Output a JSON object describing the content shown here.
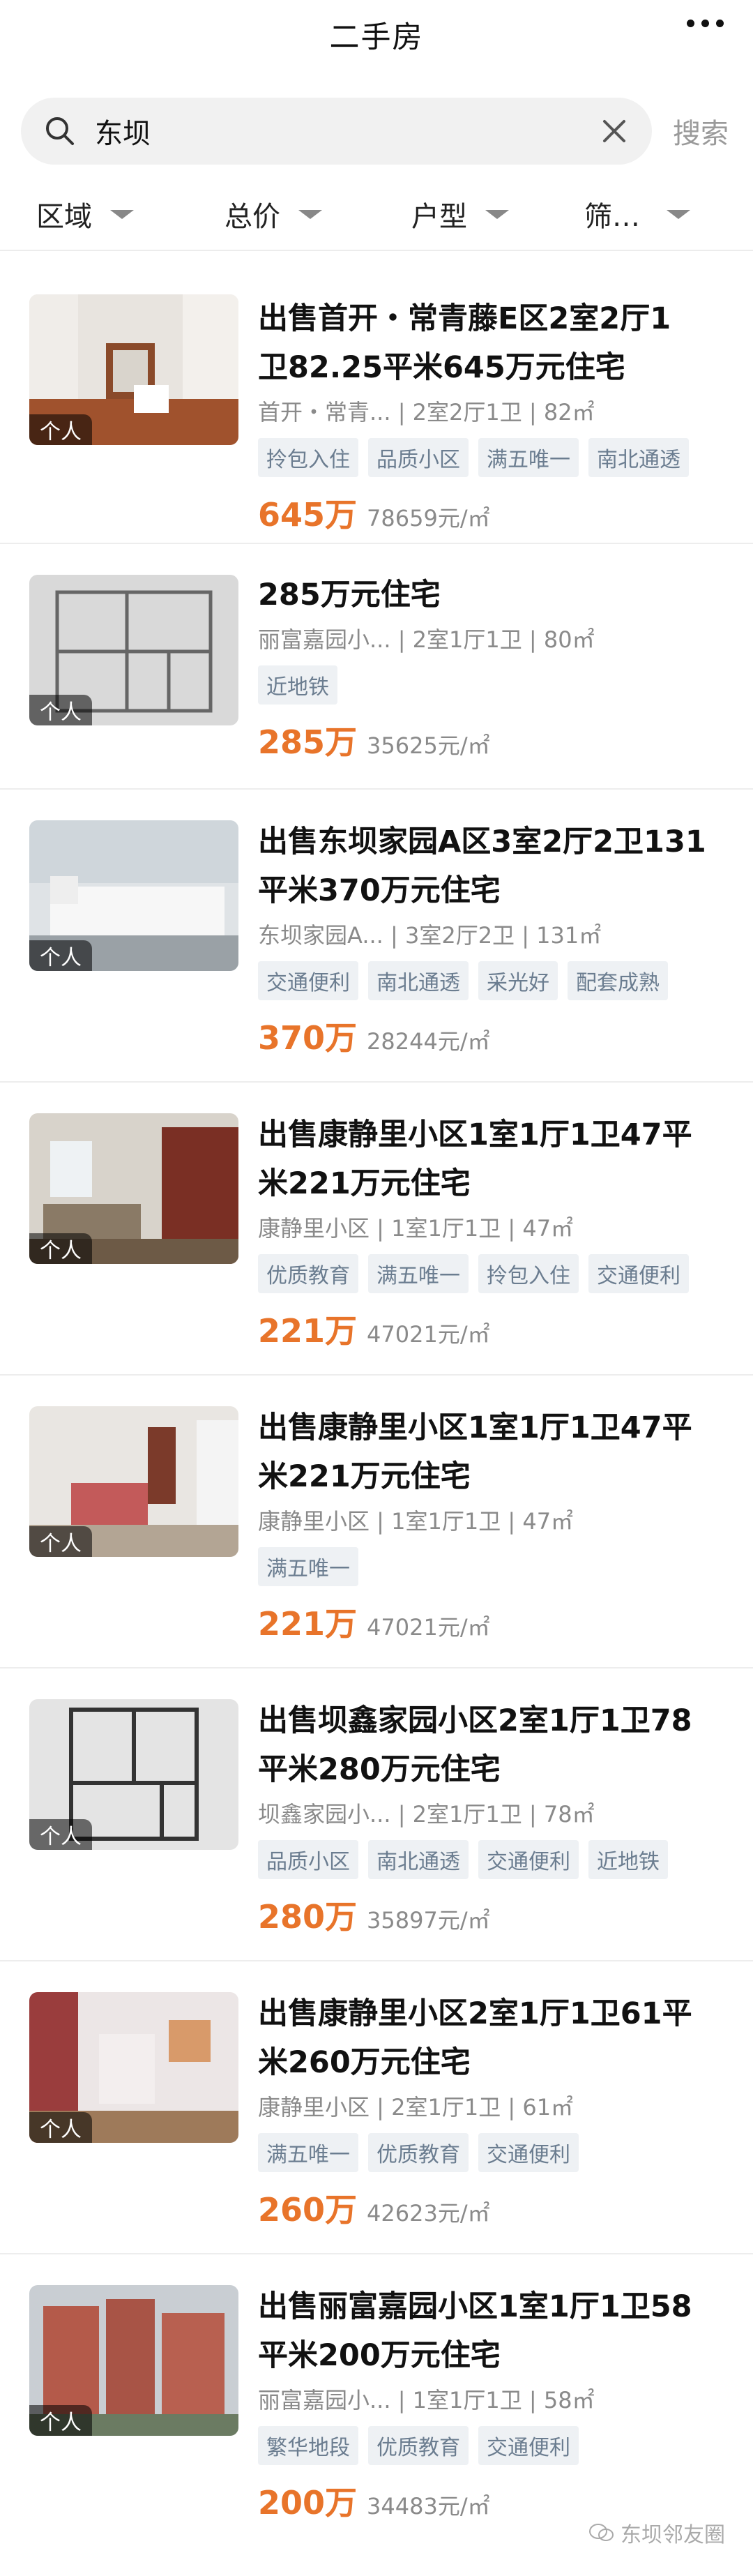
{
  "header": {
    "title": "二手房"
  },
  "search": {
    "query": "东坝",
    "button": "搜索"
  },
  "filters": [
    "区域",
    "总价",
    "户型",
    "筛…"
  ],
  "listings": [
    {
      "title": "出售首开・常青藤E区2室2厅1卫82.25平米645万元住宅",
      "title_lines": [
        "出售首开・常青藤E区2室2厅1",
        "卫82.25平米645万元住宅"
      ],
      "meta": "首开・常青... | 2室2厅1卫 | 82㎡",
      "tags": [
        "拎包入住",
        "品质小区",
        "满五唯一",
        "南北通透"
      ],
      "price": "645万",
      "unit_price": "78659元/㎡",
      "badge": "个人"
    },
    {
      "title": "285万元住宅",
      "title_lines": [
        "285万元住宅"
      ],
      "meta": "丽富嘉园小... | 2室1厅1卫 | 80㎡",
      "tags": [
        "近地铁"
      ],
      "price": "285万",
      "unit_price": "35625元/㎡",
      "badge": "个人"
    },
    {
      "title": "出售东坝家园A区3室2厅2卫131平米370万元住宅",
      "title_lines": [
        "出售东坝家园A区3室2厅2卫131",
        "平米370万元住宅"
      ],
      "meta": "东坝家园A... | 3室2厅2卫 | 131㎡",
      "tags": [
        "交通便利",
        "南北通透",
        "采光好",
        "配套成熟"
      ],
      "price": "370万",
      "unit_price": "28244元/㎡",
      "badge": "个人"
    },
    {
      "title": "出售康静里小区1室1厅1卫47平米221万元住宅",
      "title_lines": [
        "出售康静里小区1室1厅1卫47平",
        "米221万元住宅"
      ],
      "meta": "康静里小区 | 1室1厅1卫 | 47㎡",
      "tags": [
        "优质教育",
        "满五唯一",
        "拎包入住",
        "交通便利"
      ],
      "price": "221万",
      "unit_price": "47021元/㎡",
      "badge": "个人"
    },
    {
      "title": "出售康静里小区1室1厅1卫47平米221万元住宅",
      "title_lines": [
        "出售康静里小区1室1厅1卫47平",
        "米221万元住宅"
      ],
      "meta": "康静里小区 | 1室1厅1卫 | 47㎡",
      "tags": [
        "满五唯一"
      ],
      "price": "221万",
      "unit_price": "47021元/㎡",
      "badge": "个人"
    },
    {
      "title": "出售坝鑫家园小区2室1厅1卫78平米280万元住宅",
      "title_lines": [
        "出售坝鑫家园小区2室1厅1卫78",
        "平米280万元住宅"
      ],
      "meta": "坝鑫家园小... | 2室1厅1卫 | 78㎡",
      "tags": [
        "品质小区",
        "南北通透",
        "交通便利",
        "近地铁"
      ],
      "price": "280万",
      "unit_price": "35897元/㎡",
      "badge": "个人"
    },
    {
      "title": "出售康静里小区2室1厅1卫61平米260万元住宅",
      "title_lines": [
        "出售康静里小区2室1厅1卫61平",
        "米260万元住宅"
      ],
      "meta": "康静里小区 | 2室1厅1卫 | 61㎡",
      "tags": [
        "满五唯一",
        "优质教育",
        "交通便利"
      ],
      "price": "260万",
      "unit_price": "42623元/㎡",
      "badge": "个人"
    },
    {
      "title": "出售丽富嘉园小区1室1厅1卫58平米200万元住宅",
      "title_lines": [
        "出售丽富嘉园小区1室1厅1卫58",
        "平米200万元住宅"
      ],
      "meta": "丽富嘉园小... | 1室1厅1卫 | 58㎡",
      "tags": [
        "繁华地段",
        "优质教育",
        "交通便利"
      ],
      "price": "200万",
      "unit_price": "34483元/㎡",
      "badge": "个人"
    }
  ],
  "watermark": "东坝邻友圈",
  "colors": {
    "price": "#e8742a",
    "tag_bg": "#eef1f4",
    "tag_text": "#6b7d90"
  }
}
